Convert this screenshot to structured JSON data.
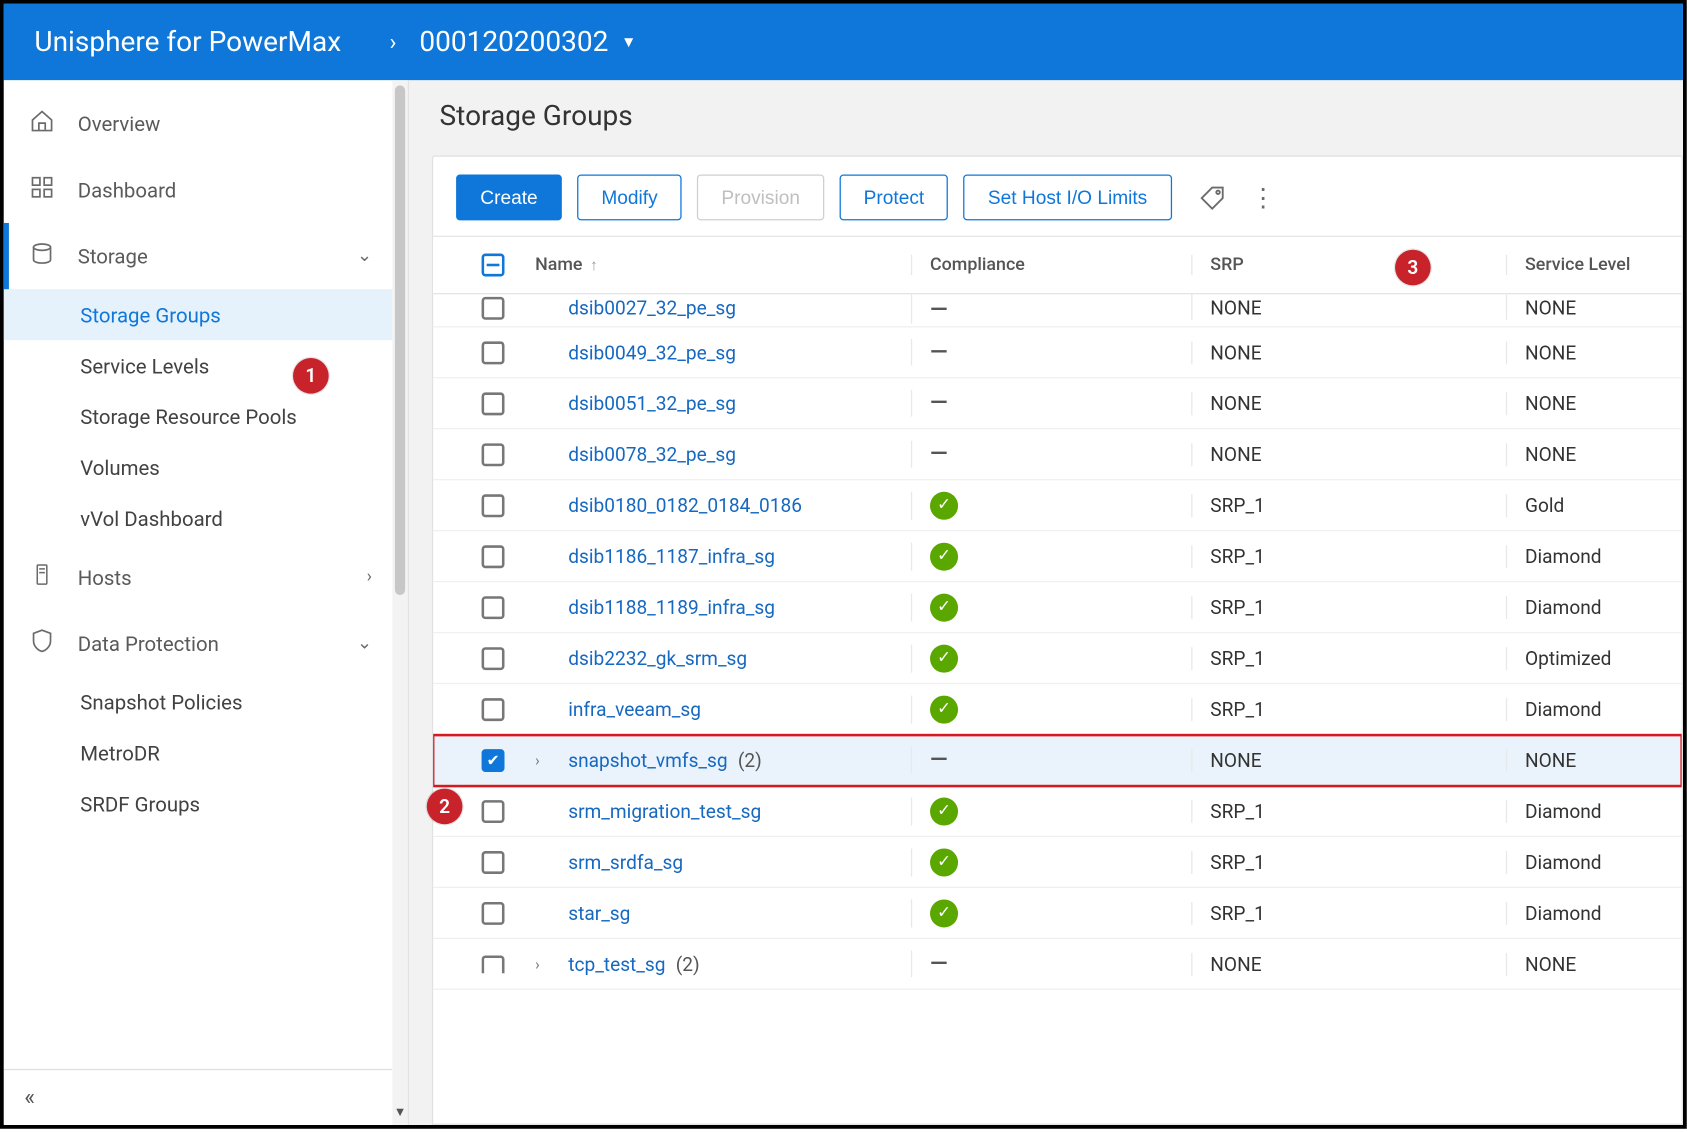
{
  "header": {
    "brand": "Unisphere for PowerMax",
    "array_id": "000120200302"
  },
  "sidebar": {
    "overview": "Overview",
    "dashboard": "Dashboard",
    "storage": {
      "label": "Storage",
      "storage_groups": "Storage Groups",
      "service_levels": "Service Levels",
      "srp": "Storage Resource Pools",
      "volumes": "Volumes",
      "vvol": "vVol Dashboard"
    },
    "hosts": "Hosts",
    "data_protection": {
      "label": "Data Protection",
      "snapshot_policies": "Snapshot Policies",
      "metrodr": "MetroDR",
      "srdf_groups": "SRDF Groups"
    }
  },
  "page": {
    "title": "Storage Groups"
  },
  "toolbar": {
    "create": "Create",
    "modify": "Modify",
    "provision": "Provision",
    "protect": "Protect",
    "set_host_io": "Set Host I/O Limits"
  },
  "columns": {
    "name": "Name",
    "compliance": "Compliance",
    "srp": "SRP",
    "service_level": "Service Level"
  },
  "rows": [
    {
      "name": "dsib0027_32_pe_sg",
      "compliance": "dash",
      "srp": "NONE",
      "svc": "NONE",
      "partialTop": true
    },
    {
      "name": "dsib0049_32_pe_sg",
      "compliance": "dash",
      "srp": "NONE",
      "svc": "NONE"
    },
    {
      "name": "dsib0051_32_pe_sg",
      "compliance": "dash",
      "srp": "NONE",
      "svc": "NONE"
    },
    {
      "name": "dsib0078_32_pe_sg",
      "compliance": "dash",
      "srp": "NONE",
      "svc": "NONE"
    },
    {
      "name": "dsib0180_0182_0184_0186",
      "compliance": "ok",
      "srp": "SRP_1",
      "svc": "Gold"
    },
    {
      "name": "dsib1186_1187_infra_sg",
      "compliance": "ok",
      "srp": "SRP_1",
      "svc": "Diamond"
    },
    {
      "name": "dsib1188_1189_infra_sg",
      "compliance": "ok",
      "srp": "SRP_1",
      "svc": "Diamond"
    },
    {
      "name": "dsib2232_gk_srm_sg",
      "compliance": "ok",
      "srp": "SRP_1",
      "svc": "Optimized"
    },
    {
      "name": "infra_veeam_sg",
      "compliance": "ok",
      "srp": "SRP_1",
      "svc": "Diamond"
    },
    {
      "name": "snapshot_vmfs_sg",
      "suffix": "(2)",
      "compliance": "dash",
      "srp": "NONE",
      "svc": "NONE",
      "checked": true,
      "expandable": true,
      "selected": true
    },
    {
      "name": "srm_migration_test_sg",
      "compliance": "ok",
      "srp": "SRP_1",
      "svc": "Diamond"
    },
    {
      "name": "srm_srdfa_sg",
      "compliance": "ok",
      "srp": "SRP_1",
      "svc": "Diamond"
    },
    {
      "name": "star_sg",
      "compliance": "ok",
      "srp": "SRP_1",
      "svc": "Diamond"
    },
    {
      "name": "tcp_test_sg",
      "suffix": "(2)",
      "compliance": "dash",
      "srp": "NONE",
      "svc": "NONE",
      "expandable": true,
      "partialCheck": true
    }
  ],
  "callouts": {
    "c1": "1",
    "c2": "2",
    "c3": "3"
  }
}
